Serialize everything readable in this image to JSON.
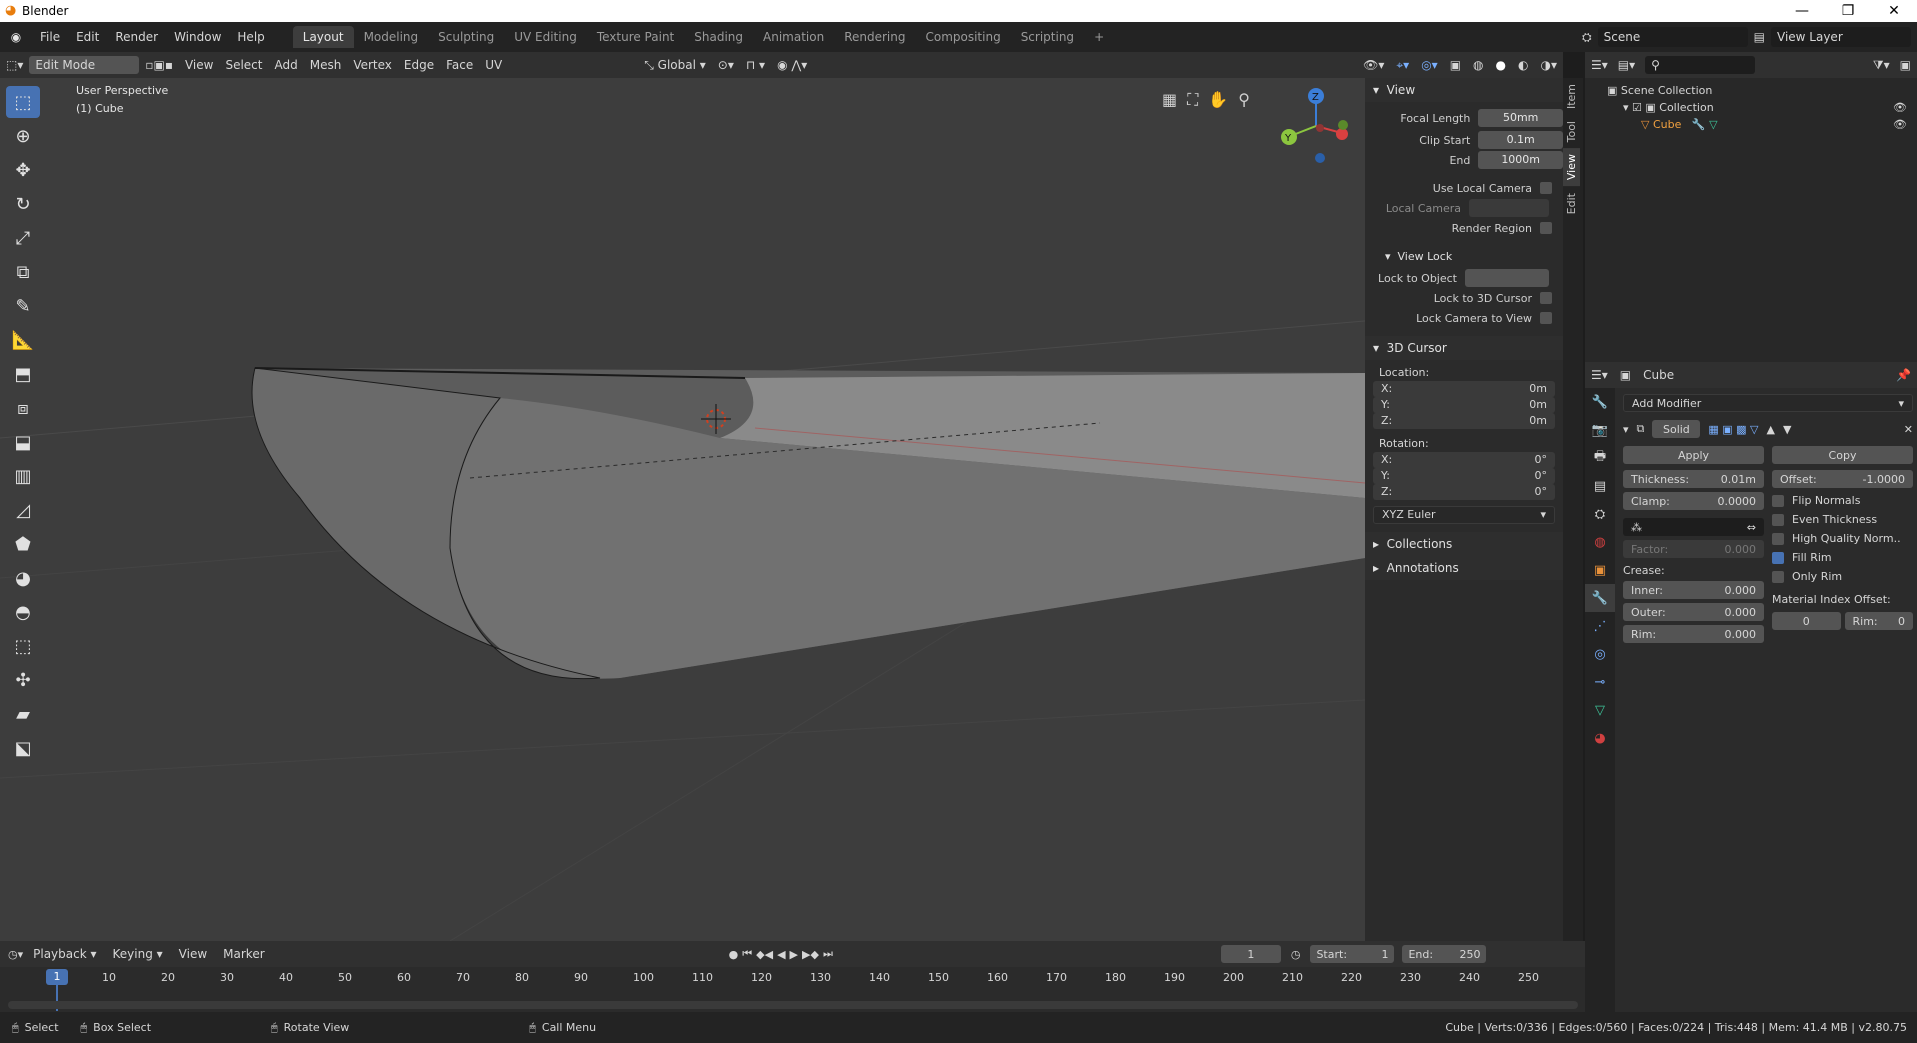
{
  "titlebar": {
    "title": "Blender",
    "minimize": "—",
    "maximize": "❐",
    "close": "✕"
  },
  "menu": {
    "file": "File",
    "edit": "Edit",
    "render": "Render",
    "window": "Window",
    "help": "Help"
  },
  "workspaces": [
    "Layout",
    "Modeling",
    "Sculpting",
    "UV Editing",
    "Texture Paint",
    "Shading",
    "Animation",
    "Rendering",
    "Compositing",
    "Scripting"
  ],
  "scene": {
    "name": "Scene",
    "view_layer": "View Layer"
  },
  "vp_header": {
    "mode": "Edit Mode",
    "view": "View",
    "select": "Select",
    "add": "Add",
    "mesh": "Mesh",
    "vertex": "Vertex",
    "edge": "Edge",
    "face": "Face",
    "uv": "UV",
    "orientation": "Global"
  },
  "viewport": {
    "perspective": "User Perspective",
    "object": "(1) Cube",
    "gizmo_z": "Z",
    "gizmo_y": "Y"
  },
  "npanel": {
    "tabs": [
      "Item",
      "Tool",
      "View",
      "Edit"
    ],
    "view_title": "View",
    "focal_length_label": "Focal Length",
    "focal_length": "50mm",
    "clip_start_label": "Clip Start",
    "clip_start": "0.1m",
    "end_label": "End",
    "end": "1000m",
    "use_local_camera": "Use Local Camera",
    "local_camera": "Local Camera",
    "render_region": "Render Region",
    "view_lock_title": "View Lock",
    "lock_to_object": "Lock to Object",
    "lock_to_3d_cursor": "Lock to 3D Cursor",
    "lock_camera_to_view": "Lock Camera to View",
    "cursor_title": "3D Cursor",
    "location_label": "Location:",
    "loc_x": "0m",
    "loc_y": "0m",
    "loc_z": "0m",
    "rotation_label": "Rotation:",
    "rot_x": "0°",
    "rot_y": "0°",
    "rot_z": "0°",
    "x": "X:",
    "y": "Y:",
    "z": "Z:",
    "rotation_mode": "XYZ Euler",
    "collections": "Collections",
    "annotations": "Annotations"
  },
  "outliner": {
    "scene_collection": "Scene Collection",
    "collection": "Collection",
    "cube": "Cube"
  },
  "properties": {
    "object_name": "Cube",
    "add_modifier": "Add Modifier",
    "modifier_name": "Solid",
    "apply": "Apply",
    "copy": "Copy",
    "thickness_label": "Thickness:",
    "thickness": "0.01m",
    "offset_label": "Offset:",
    "offset": "-1.0000",
    "clamp_label": "Clamp:",
    "clamp": "0.0000",
    "flip_normals": "Flip Normals",
    "even_thickness": "Even Thickness",
    "high_quality": "High Quality Norm..",
    "fill_rim": "Fill Rim",
    "only_rim": "Only Rim",
    "factor_label": "Factor:",
    "factor": "0.000",
    "crease_label": "Crease:",
    "inner_label": "Inner:",
    "inner": "0.000",
    "outer_label": "Outer:",
    "outer": "0.000",
    "rim_label": "Rim:",
    "rim": "0.000",
    "material_index_label": "Material Index Offset:",
    "mat_offset": "0",
    "mat_rim_label": "Rim:",
    "mat_rim": "0"
  },
  "timeline": {
    "playback": "Playback",
    "keying": "Keying",
    "view": "View",
    "marker": "Marker",
    "current_frame": "1",
    "start_label": "Start:",
    "start": "1",
    "end_label": "End:",
    "end": "250",
    "ruler": [
      "10",
      "20",
      "30",
      "40",
      "50",
      "60",
      "70",
      "80",
      "90",
      "100",
      "110",
      "120",
      "130",
      "140",
      "150",
      "160",
      "170",
      "180",
      "190",
      "200",
      "210",
      "220",
      "230",
      "240",
      "250"
    ],
    "playhead": "1"
  },
  "statusbar": {
    "select": "Select",
    "box_select": "Box Select",
    "rotate_view": "Rotate View",
    "call_menu": "Call Menu",
    "stats": "Cube | Verts:0/336 | Edges:0/560 | Faces:0/224 | Tris:448 | Mem: 41.4 MB | v2.80.75"
  }
}
